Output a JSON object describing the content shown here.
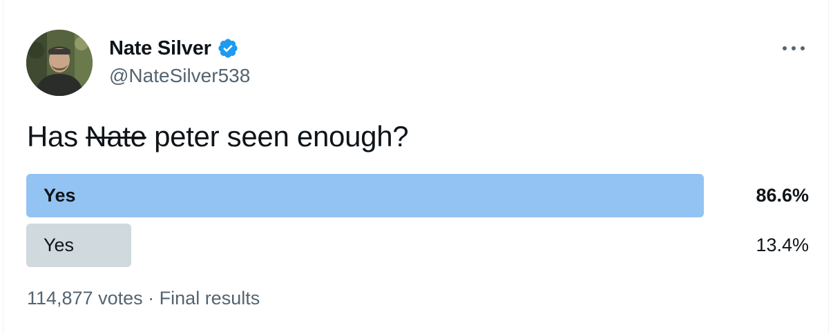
{
  "author": {
    "name": "Nate Silver",
    "handle": "@NateSilver538",
    "verified_color": "#1d9bf0"
  },
  "tweet": {
    "text_before": "Has ",
    "struck_word": "Nate",
    "text_after": " peter seen enough?"
  },
  "poll": {
    "options": [
      {
        "label": "Yes",
        "percent_text": "86.6%",
        "fraction": 0.866,
        "color": "#93c3f2",
        "winner": true
      },
      {
        "label": "Yes",
        "percent_text": "13.4%",
        "fraction": 0.134,
        "color": "#cfd9de",
        "winner": false
      }
    ],
    "votes": "114,877 votes",
    "separator": "·",
    "status": "Final results"
  },
  "icons": {
    "avatar": "profile-photo",
    "verified": "verified-badge-icon",
    "more": "more-options-icon"
  }
}
